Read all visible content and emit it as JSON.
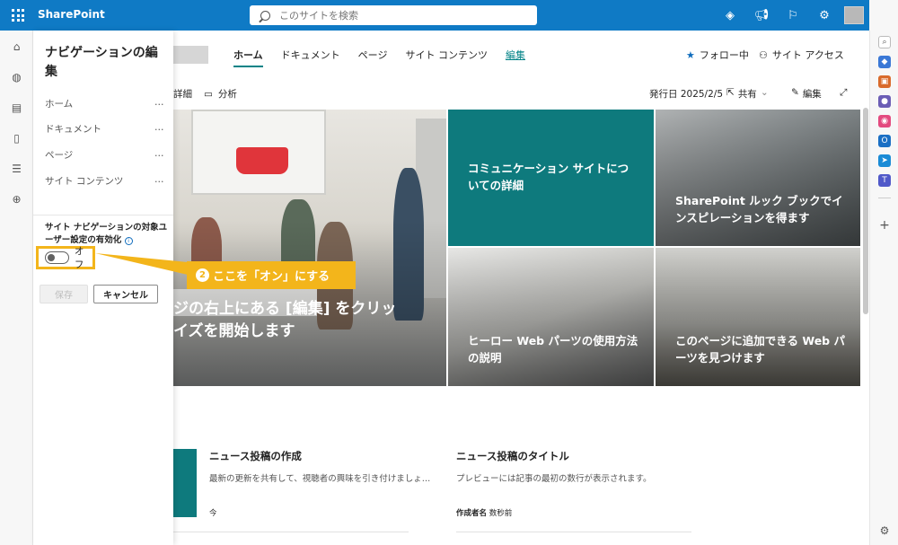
{
  "app": {
    "title": "SharePoint"
  },
  "search": {
    "placeholder": "このサイトを検索"
  },
  "site_nav": {
    "items": [
      {
        "label": "ホーム",
        "active": true
      },
      {
        "label": "ドキュメント"
      },
      {
        "label": "ページ"
      },
      {
        "label": "サイト コンテンツ"
      },
      {
        "label": "編集",
        "link": true
      }
    ],
    "follow": "フォロー中",
    "site_access": "サイト アクセス"
  },
  "command_bar": {
    "details": "詳細",
    "analytics": "分析",
    "published": "発行日 2025/2/5",
    "share": "共有",
    "edit": "編集"
  },
  "hero": {
    "main_text_line1": "ジの右上にある [編集] をクリッ",
    "main_text_line2": "イズを開始します",
    "tiles": [
      {
        "text": "コミュニケーション サイトについての詳細"
      },
      {
        "text": "SharePoint ルック ブックでインスピレーションを得ます"
      },
      {
        "text": "ヒーロー Web パーツの使用方法の説明"
      },
      {
        "text": "このページに追加できる Web パーツを見つけます"
      }
    ]
  },
  "news": [
    {
      "title": "ニュース投稿の作成",
      "description": "最新の更新を共有して、視聴者の興味を引き付けましょ…",
      "meta": "今"
    },
    {
      "title": "ニュース投稿のタイトル",
      "description": "プレビューには記事の最初の数行が表示されます。",
      "author": "作成者名",
      "time": "数秒前"
    }
  ],
  "nav_panel": {
    "title": "ナビゲーションの編集",
    "items": [
      "ホーム",
      "ドキュメント",
      "ページ",
      "サイト コンテンツ"
    ],
    "more": "…",
    "audience_label": "サイト ナビゲーションの対象ユーザー設定の有効化",
    "toggle_state": "オフ",
    "save": "保存",
    "cancel": "キャンセル"
  },
  "callout": {
    "number": "2",
    "text": "ここを「オン」にする"
  },
  "colors": {
    "brand": "#0f7ac5",
    "accent": "#038387",
    "teal": "#0e7a7d",
    "highlight": "#f3b51b"
  }
}
